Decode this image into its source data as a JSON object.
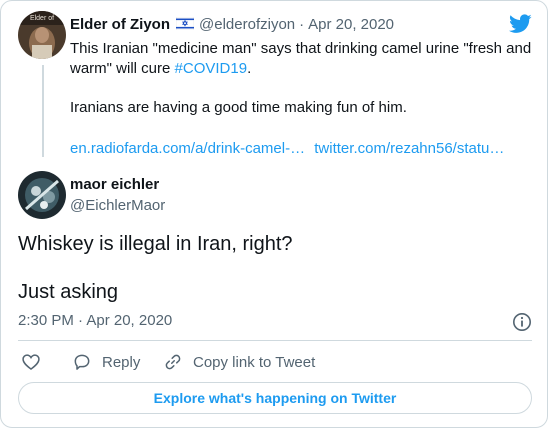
{
  "quoted_tweet": {
    "author_name": "Elder of Ziyon",
    "flag_icon": "israel-flag-icon",
    "handle": "@elderofziyon",
    "separator": "·",
    "date": "Apr 20, 2020",
    "line1": "This Iranian \"medicine man\" says that drinking camel urine \"fresh and",
    "line2_prefix": "warm\" will cure ",
    "hashtag": "#COVID19",
    "line2_suffix": ".",
    "paragraph2": "Iranians are having a good time making fun of him.",
    "link1": "en.radiofarda.com/a/drink-camel-…",
    "link2": "twitter.com/rezahn56/statu…",
    "avatar_text": "Elder of"
  },
  "reply_tweet": {
    "author_name": "maor eichler",
    "handle": "@EichlerMaor",
    "text_line1": "Whiskey is illegal in Iran, right?",
    "text_line2": "Just asking",
    "time": "2:30 PM · Apr 20, 2020"
  },
  "actions": {
    "reply_label": "Reply",
    "copy_link_label": "Copy link to Tweet"
  },
  "explore_label": "Explore what's happening on Twitter",
  "colors": {
    "accent": "#1d9bf0",
    "text": "#0f1419",
    "muted": "#536471",
    "border": "#cfd9de"
  },
  "icons": [
    "twitter-bird-icon",
    "israel-flag-icon",
    "info-icon",
    "heart-icon",
    "reply-icon",
    "copy-link-icon"
  ]
}
